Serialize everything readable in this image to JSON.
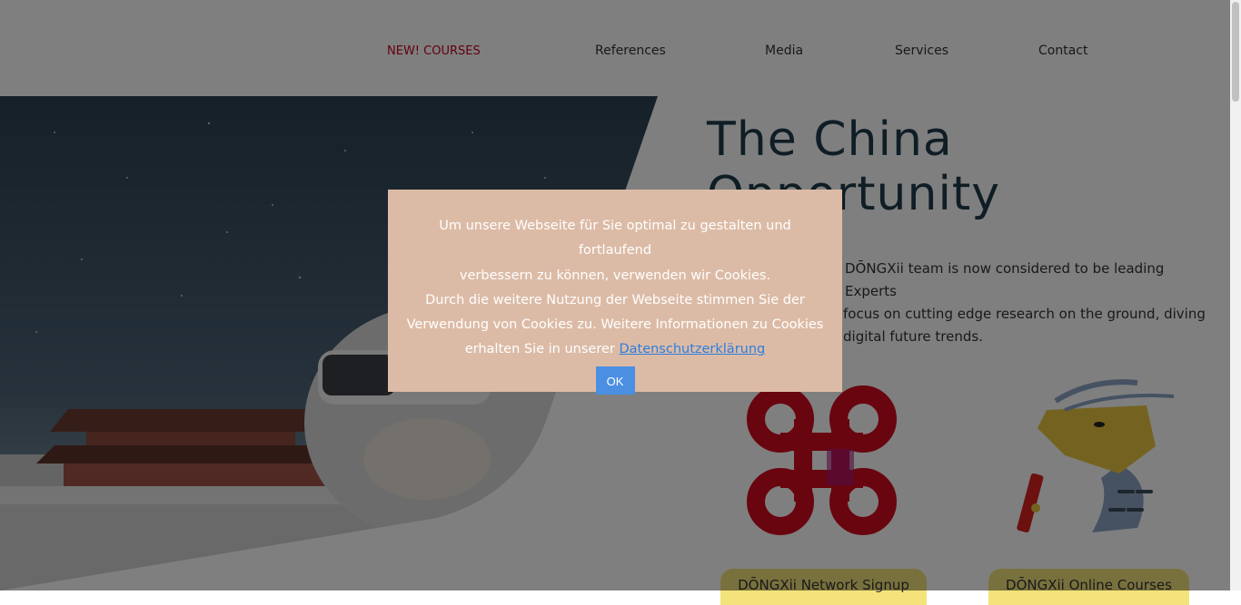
{
  "nav": {
    "items": [
      {
        "label": "NEW! COURSES"
      },
      {
        "label": "References"
      },
      {
        "label": "Media"
      },
      {
        "label": "Services"
      },
      {
        "label": "Contact"
      }
    ]
  },
  "hero": {
    "title_line1": "The China",
    "title_line2": "Opportunity",
    "intro_line1": "DŌNGXii team is now considered to be leading Experts",
    "intro_line2": "focus on cutting edge research on the ground, diving",
    "intro_line3": "digital future trends."
  },
  "cards": [
    {
      "label": "DŌNGXii Network Signup",
      "icon": "knot-icon"
    },
    {
      "label": "DŌNGXii Online Courses",
      "icon": "dragon-icon"
    }
  ],
  "cookie": {
    "line1": "Um unsere Webseite für Sie optimal zu gestalten und fortlaufend",
    "line2": "verbessern zu können, verwenden wir Cookies.",
    "line3": "Durch die weitere Nutzung der Webseite stimmen Sie der",
    "line4": "Verwendung von Cookies zu. Weitere Informationen zu Cookies",
    "line5_prefix": "erhalten Sie in unserer",
    "link": "Datenschutzerklärung",
    "ok_label": "OK"
  },
  "colors": {
    "accent_red": "#c4001a",
    "modal_bg": "#dcbba6",
    "ok_button": "#4a8fe2",
    "cta_yellow": "#f3e37a"
  }
}
